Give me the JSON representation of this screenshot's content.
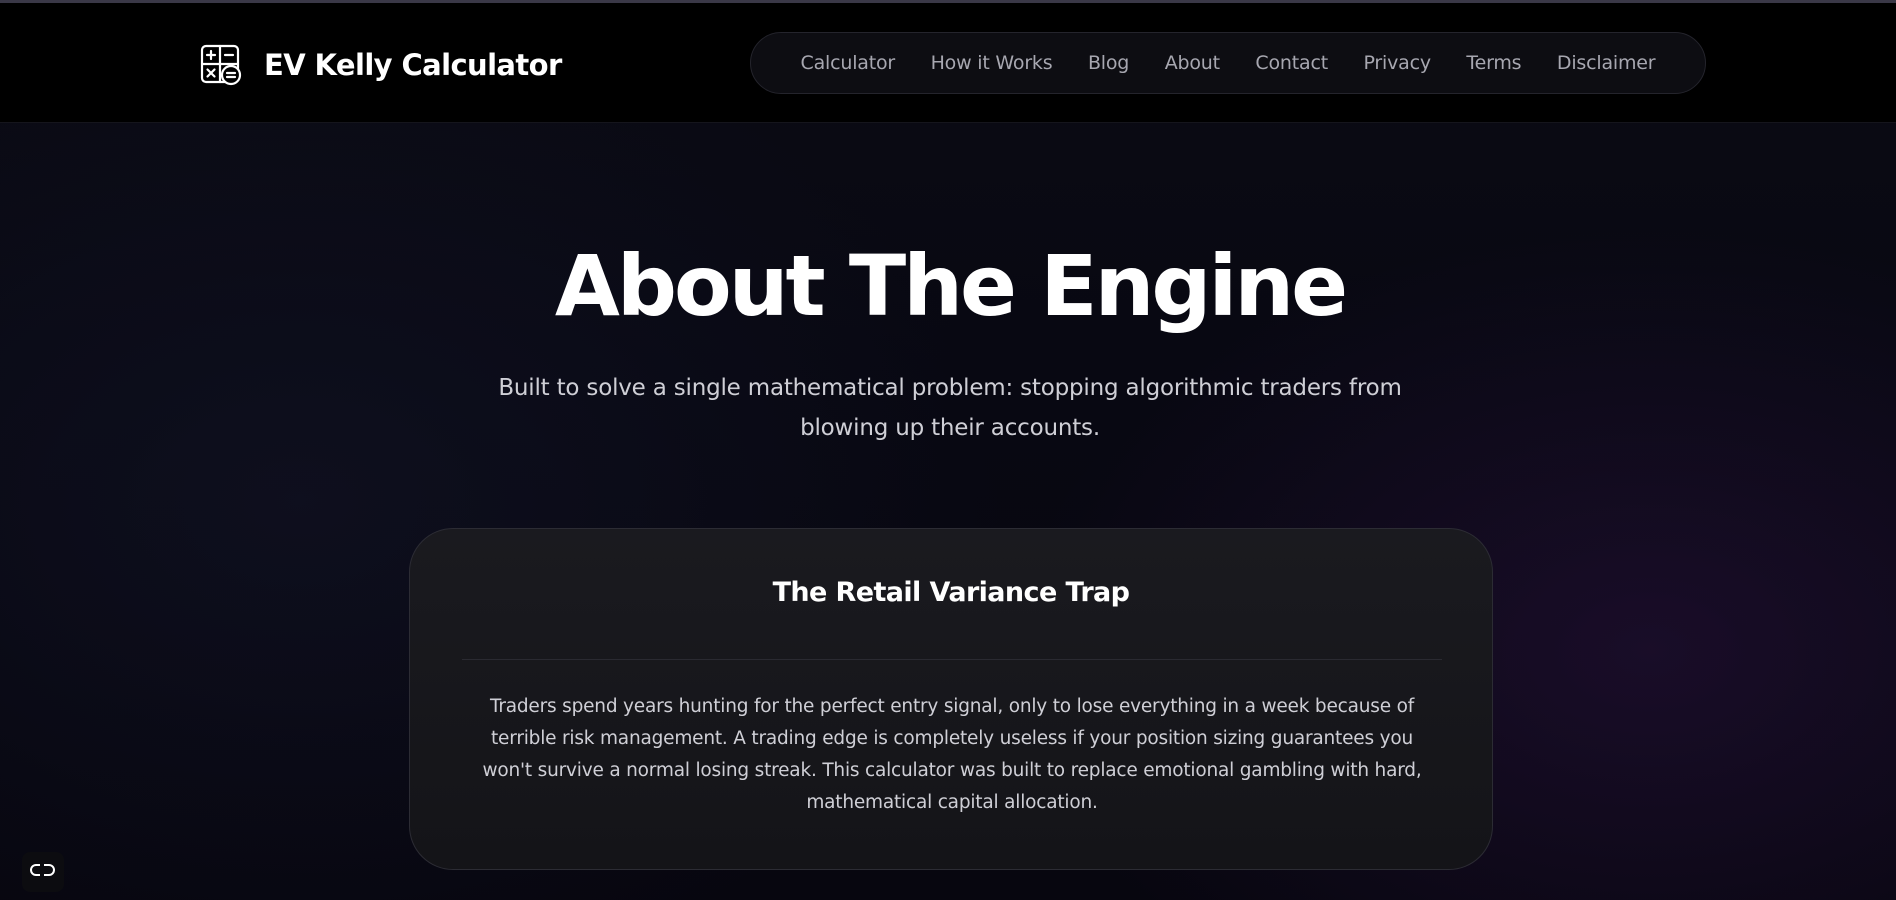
{
  "header": {
    "brand_title": "EV Kelly Calculator",
    "brand_icon": "calculator-icon"
  },
  "nav": {
    "items": [
      {
        "label": "Calculator"
      },
      {
        "label": "How it Works"
      },
      {
        "label": "Blog"
      },
      {
        "label": "About"
      },
      {
        "label": "Contact"
      },
      {
        "label": "Privacy"
      },
      {
        "label": "Terms"
      },
      {
        "label": "Disclaimer"
      }
    ]
  },
  "hero": {
    "title": "About The Engine",
    "subtitle": "Built to solve a single mathematical problem: stopping algorithmic traders from blowing up their accounts."
  },
  "card": {
    "title": "The Retail Variance Trap",
    "body": "Traders spend years hunting for the perfect entry signal, only to lose everything in a week because of terrible risk management. A trading edge is completely useless if your position sizing guarantees you won't survive a normal losing streak. This calculator was built to replace emotional gambling with hard, mathematical capital allocation."
  },
  "floating": {
    "icon": "link-icon"
  },
  "colors": {
    "background": "#07060f",
    "header": "#000000",
    "nav_text": "#a7a7b0",
    "card_bg": "#17171c",
    "text_muted": "#cfcfd6"
  }
}
